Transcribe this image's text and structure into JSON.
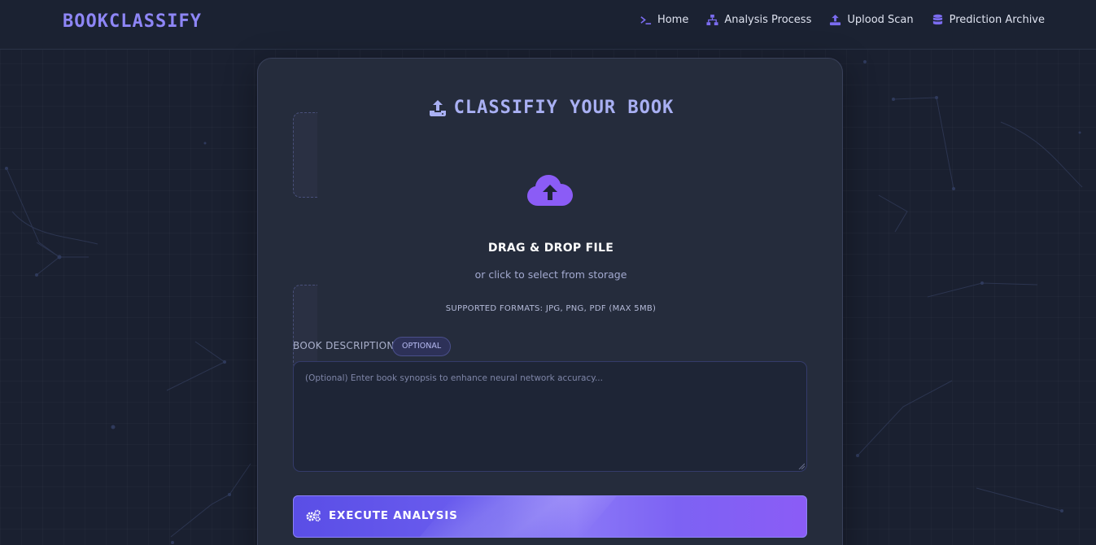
{
  "app": {
    "brand": "BOOKCLASSIFY"
  },
  "nav": {
    "items": [
      {
        "label": "Home",
        "icon": "terminal-icon"
      },
      {
        "label": "Analysis Process",
        "icon": "sitemap-icon"
      },
      {
        "label": "Uplood Scan",
        "icon": "upload-icon"
      },
      {
        "label": "Prediction Archive",
        "icon": "database-icon"
      }
    ]
  },
  "card": {
    "title": "CLASSIFIY YOUR BOOK",
    "title_icon": "upload-icon",
    "drop_title": "DRAG & DROP FILE",
    "drop_sub": "or click to select from storage",
    "formats": "SUPPORTED FORMATS: JPG, PNG, PDF (MAX 5MB)",
    "cloud_icon": "cloud-upload-icon"
  },
  "description": {
    "label": "BOOK DESCRIPTION",
    "badge": "OPTIONAL",
    "placeholder": "(Optional) Enter book synopsis to enhance neural network accuracy..."
  },
  "action": {
    "label": "EXECUTE ANALYSIS",
    "icon": "cogs-icon"
  },
  "colors": {
    "accent": "#8b5cf6",
    "brand": "#8e86f6",
    "background": "#1a2030",
    "card": "#252c3c"
  }
}
